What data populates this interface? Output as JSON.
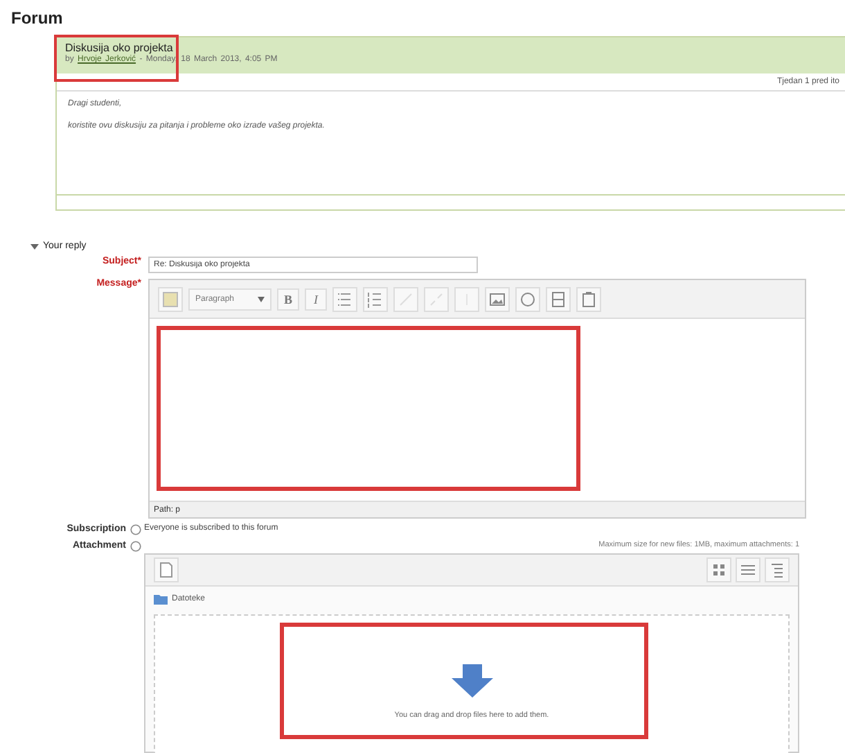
{
  "page_title": "Forum",
  "post": {
    "title": "Diskusija oko projekta",
    "by": "by",
    "author": "Hrvoje Jerković",
    "date": "- Monday, 18 March 2013, 4:05 PM",
    "section": "Tjedan 1 pred ito",
    "greeting": "Dragi studenti,",
    "body": "koristite ovu diskusiju za pitanja i probleme oko izrade vašeg projekta."
  },
  "reply": {
    "legend": "Your reply",
    "expanded": true,
    "subject": {
      "label": "Subject",
      "required": "*",
      "value": "Re: Diskusija oko projekta"
    },
    "message": {
      "label": "Message",
      "required": "*",
      "format": "Paragraph",
      "bold": "B",
      "italic": "I",
      "path": "Path: p"
    },
    "subscription": {
      "label": "Subscription",
      "value": "Everyone is subscribed to this forum"
    },
    "attachment": {
      "label": "Attachment",
      "limits": "Maximum size for new files: 1MB, maximum attachments: 1",
      "folder": "Datoteke",
      "drop_hint": "You can drag and drop files here to add them."
    }
  }
}
